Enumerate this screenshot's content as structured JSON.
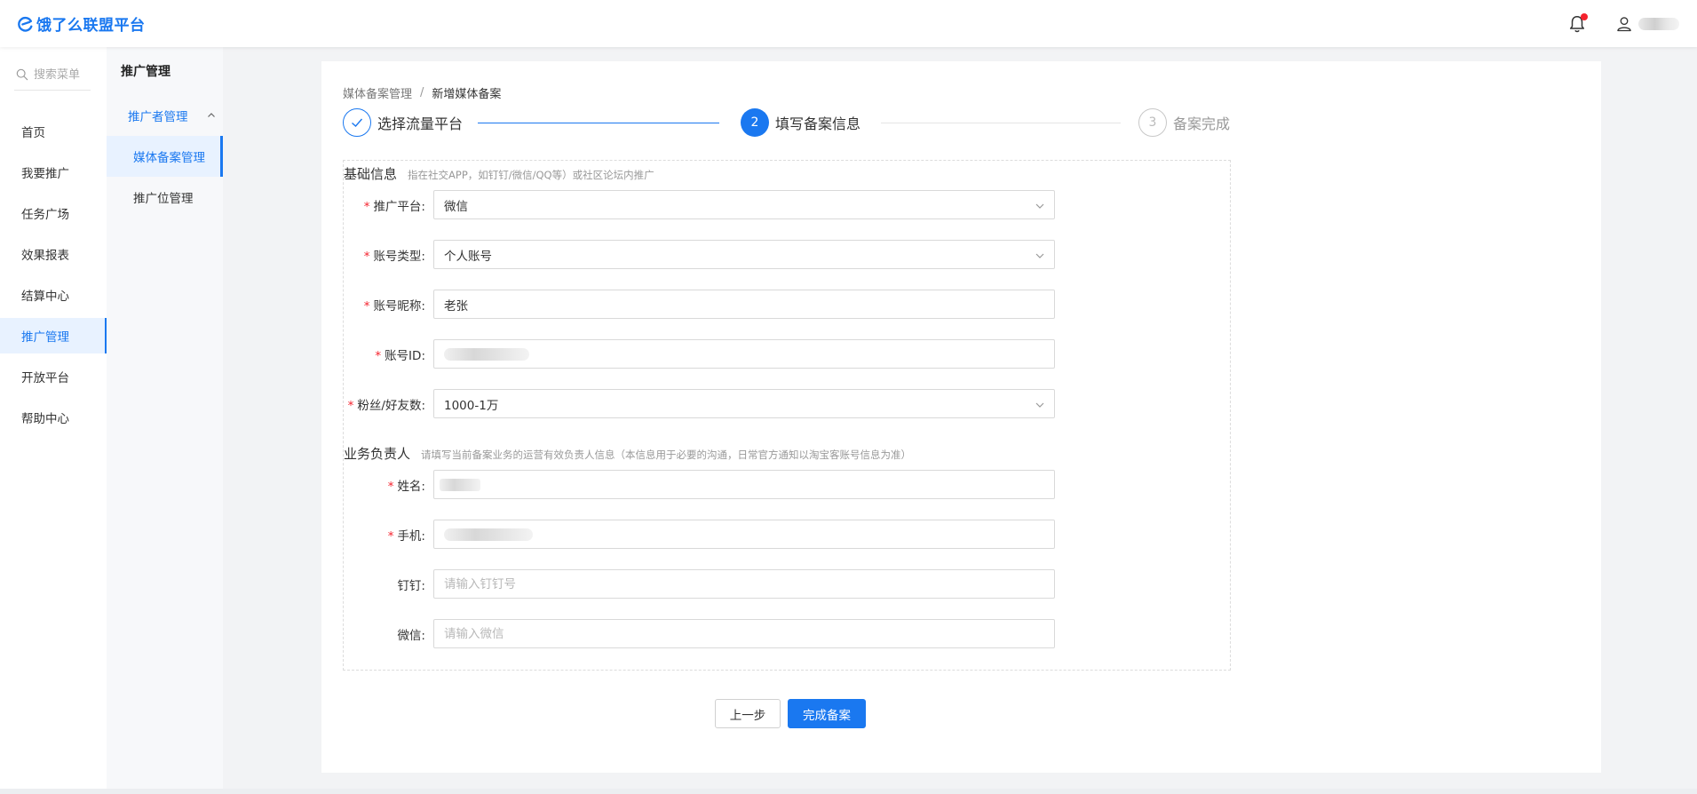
{
  "header": {
    "logo_text": "饿了么联盟平台",
    "accent": "#1a78f0"
  },
  "sidebar": {
    "search_placeholder": "搜索菜单",
    "items": [
      {
        "label": "首页"
      },
      {
        "label": "我要推广"
      },
      {
        "label": "任务广场"
      },
      {
        "label": "效果报表"
      },
      {
        "label": "结算中心"
      },
      {
        "label": "推广管理",
        "active": true
      },
      {
        "label": "开放平台"
      },
      {
        "label": "帮助中心"
      }
    ]
  },
  "subnav": {
    "title": "推广管理",
    "group_label": "推广者管理",
    "items": [
      {
        "label": "媒体备案管理",
        "active": true
      },
      {
        "label": "推广位管理"
      }
    ]
  },
  "breadcrumb": {
    "parent": "媒体备案管理",
    "separator": "/",
    "current": "新增媒体备案"
  },
  "steps": [
    {
      "label": "选择流量平台",
      "state": "done"
    },
    {
      "number": "2",
      "label": "填写备案信息",
      "state": "active"
    },
    {
      "number": "3",
      "label": "备案完成",
      "state": "pending"
    }
  ],
  "basic_info": {
    "title": "基础信息",
    "hint": "指在社交APP，如钉钉/微信/QQ等）或社区论坛内推广",
    "platform": {
      "label": "推广平台:",
      "value": "微信"
    },
    "account_type": {
      "label": "账号类型:",
      "value": "个人账号"
    },
    "nickname": {
      "label": "账号昵称:",
      "value": "老张"
    },
    "account_id": {
      "label": "账号ID:"
    },
    "followers": {
      "label": "粉丝/好友数:",
      "value": "1000-1万"
    }
  },
  "owner_info": {
    "title": "业务负责人",
    "hint": "请填写当前备案业务的运营有效负责人信息（本信息用于必要的沟通，日常官方通知以淘宝客账号信息为准）",
    "name": {
      "label": "姓名:"
    },
    "phone": {
      "label": "手机:"
    },
    "dingtalk": {
      "label": "钉钉:",
      "placeholder": "请输入钉钉号"
    },
    "wechat": {
      "label": "微信:",
      "placeholder": "请输入微信"
    }
  },
  "actions": {
    "prev_label": "上一步",
    "finish_label": "完成备案"
  }
}
